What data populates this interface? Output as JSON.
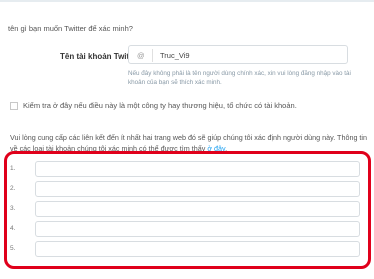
{
  "intro": "tên gì bạn muốn Twitter để xác minh?",
  "username": {
    "label": "Tên tài khoản Twitter",
    "at_symbol": "@",
    "value": "Truc_Vi9",
    "help": "Nếu đây không phải là tên người dùng chính xác, xin vui lòng đăng nhập vào tài khoản của bạn sẽ thích xác minh."
  },
  "checkbox": {
    "label": "Kiểm tra ở đây nếu điều này là một công ty hay thương hiệu, tổ chức có tài khoản.",
    "checked": false
  },
  "instructions": {
    "text": "Vui lòng cung cấp các liên kết đến ít nhất hai trang web đó sẽ giúp chúng tôi xác định người dùng này. Thông tin về các loại tài khoản chúng tôi xác minh có thể được tìm thấy ",
    "link": "ở đây",
    "after": "."
  },
  "links": [
    {
      "num": "1.",
      "value": ""
    },
    {
      "num": "2.",
      "value": ""
    },
    {
      "num": "3.",
      "value": ""
    },
    {
      "num": "4.",
      "value": ""
    },
    {
      "num": "5.",
      "value": ""
    }
  ],
  "highlight_color": "#e0001b",
  "link_color": "#1da1f2"
}
